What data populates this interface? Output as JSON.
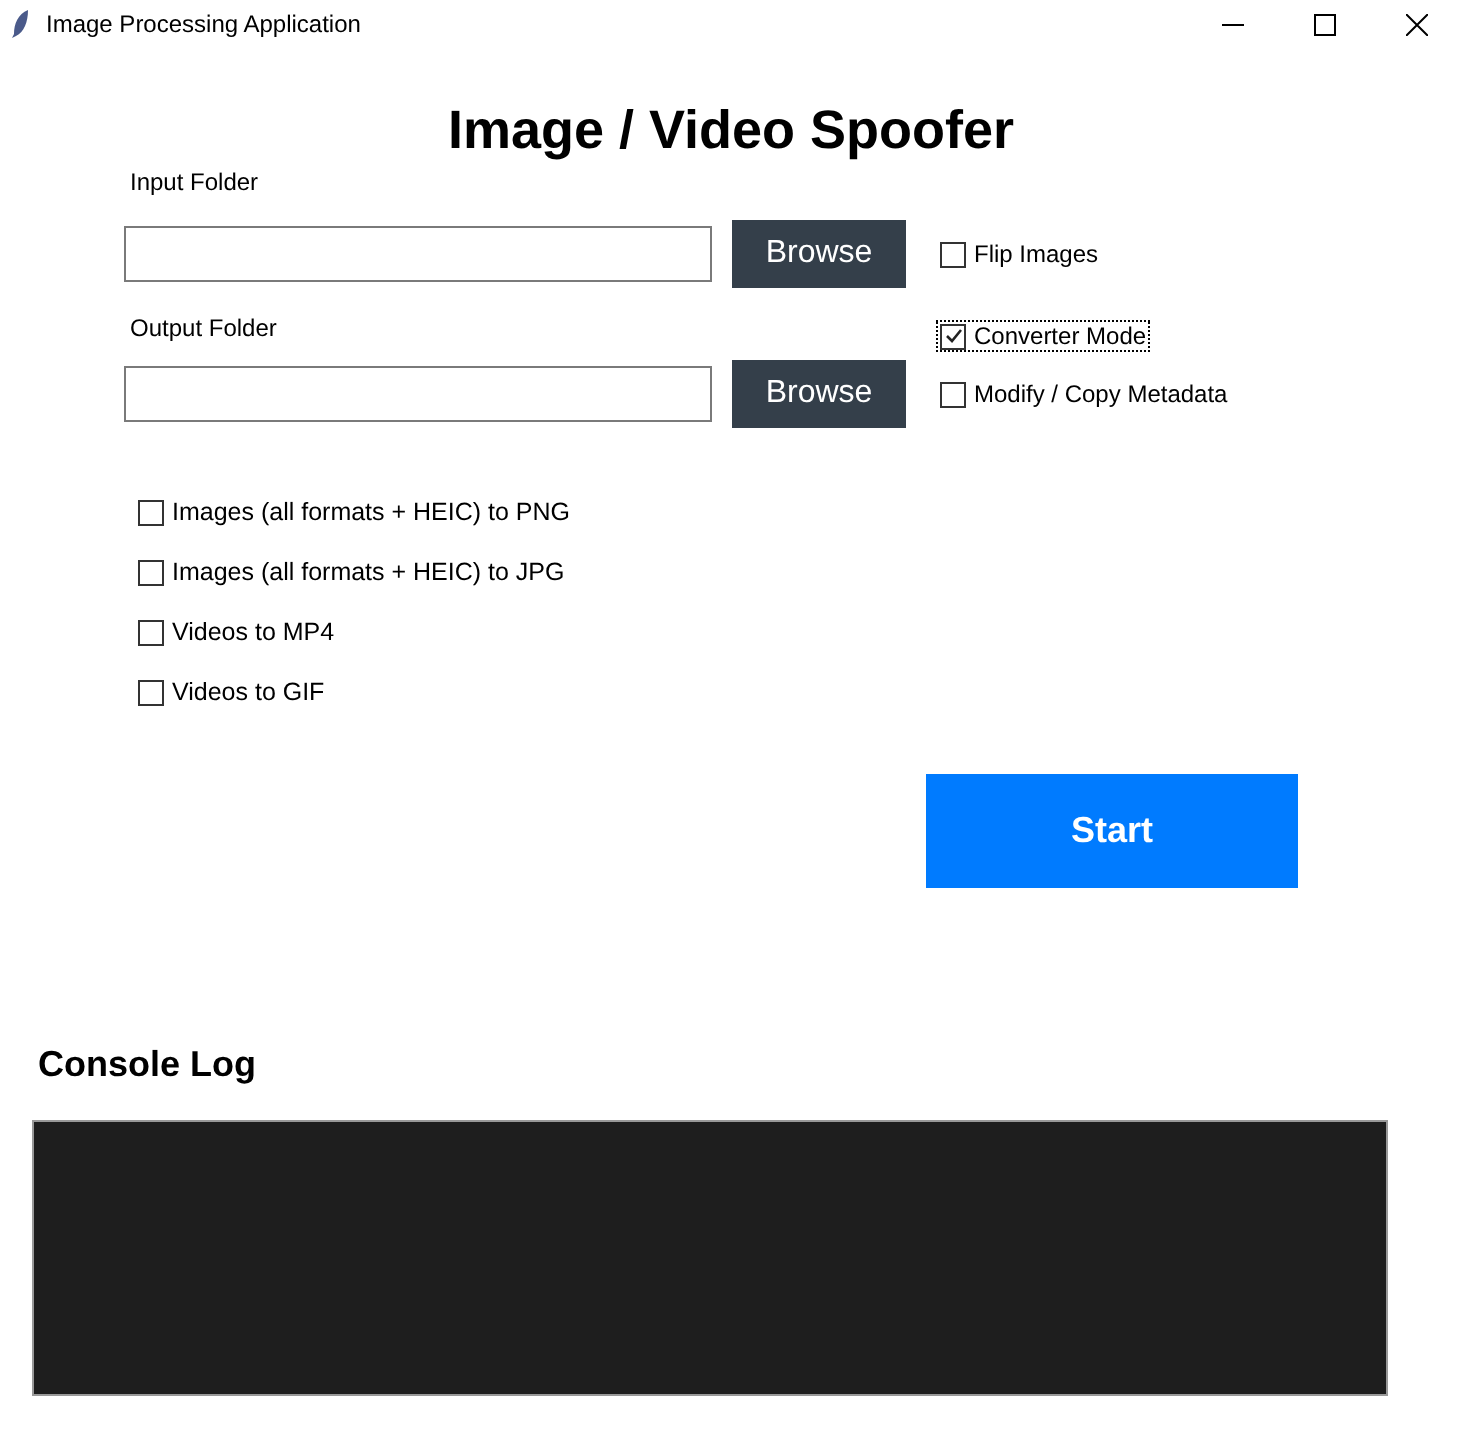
{
  "window": {
    "title": "Image Processing Application"
  },
  "heading": "Image / Video Spoofer",
  "input_folder": {
    "label": "Input Folder",
    "button": "Browse"
  },
  "output_folder": {
    "label": "Output Folder",
    "button": "Browse"
  },
  "options": [
    {
      "label": "Flip Images",
      "checked": false,
      "focused": false
    },
    {
      "label": "Converter Mode",
      "checked": true,
      "focused": true
    },
    {
      "label": "Modify / Copy Metadata",
      "checked": false,
      "focused": false
    }
  ],
  "conversions": [
    {
      "label": "Images (all formats + HEIC) to PNG",
      "checked": false
    },
    {
      "label": "Images (all formats + HEIC) to JPG",
      "checked": false
    },
    {
      "label": "Videos to MP4",
      "checked": false
    },
    {
      "label": "Videos to GIF",
      "checked": false
    }
  ],
  "start_button": "Start",
  "console": {
    "title": "Console Log"
  }
}
